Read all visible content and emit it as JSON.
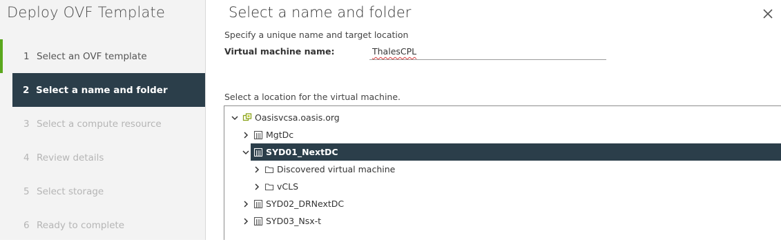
{
  "wizard": {
    "title": "Deploy OVF Template",
    "steps": [
      {
        "num": "1",
        "label": "Select an OVF template"
      },
      {
        "num": "2",
        "label": "Select a name and folder"
      },
      {
        "num": "3",
        "label": "Select a compute resource"
      },
      {
        "num": "4",
        "label": "Review details"
      },
      {
        "num": "5",
        "label": "Select storage"
      },
      {
        "num": "6",
        "label": "Ready to complete"
      }
    ]
  },
  "page": {
    "title": "Select a name and folder",
    "subtitle": "Specify a unique name and target location",
    "vm_name_label": "Virtual machine name:",
    "vm_name_value": "ThalesCPL",
    "location_label": "Select a location for the virtual machine."
  },
  "tree": {
    "root": "Oasisvcsa.oasis.org",
    "items": [
      "MgtDc",
      "SYD01_NextDC",
      "Discovered virtual machine",
      "vCLS",
      "SYD02_DRNextDC",
      "SYD03_Nsx-t"
    ]
  },
  "colors": {
    "accent_dark": "#2b3e4a",
    "done_bar": "#5aa71d",
    "rail_bg": "#f3f3f3"
  }
}
